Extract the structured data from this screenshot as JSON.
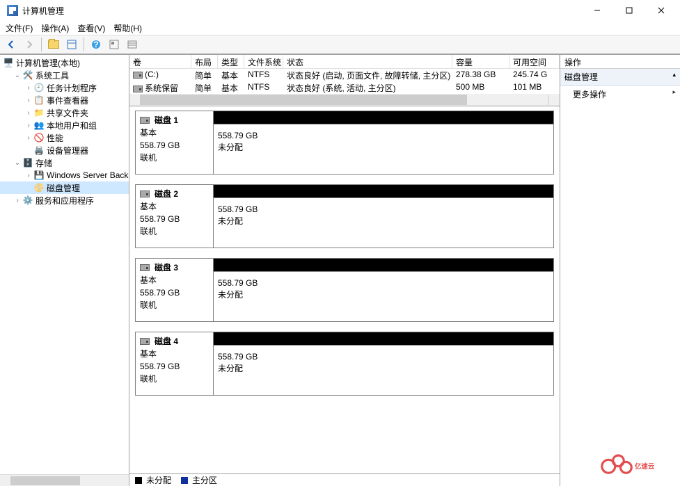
{
  "window": {
    "title": "计算机管理"
  },
  "menus": {
    "file": "文件(F)",
    "action": "操作(A)",
    "view": "查看(V)",
    "help": "帮助(H)"
  },
  "tree": {
    "root": "计算机管理(本地)",
    "system_tools": "系统工具",
    "task_scheduler": "任务计划程序",
    "event_viewer": "事件查看器",
    "shared_folders": "共享文件夹",
    "local_users": "本地用户和组",
    "performance": "性能",
    "device_manager": "设备管理器",
    "storage": "存储",
    "wsb": "Windows Server Back",
    "disk_mgmt": "磁盘管理",
    "services": "服务和应用程序"
  },
  "vol_headers": {
    "volume": "卷",
    "layout": "布局",
    "type": "类型",
    "fs": "文件系统",
    "status": "状态",
    "capacity": "容量",
    "free": "可用空间"
  },
  "volumes": [
    {
      "name": "(C:)",
      "layout": "简单",
      "type": "基本",
      "fs": "NTFS",
      "status": "状态良好 (启动, 页面文件, 故障转储, 主分区)",
      "capacity": "278.38 GB",
      "free": "245.74 G"
    },
    {
      "name": "系统保留",
      "layout": "简单",
      "type": "基本",
      "fs": "NTFS",
      "status": "状态良好 (系统, 活动, 主分区)",
      "capacity": "500 MB",
      "free": "101 MB"
    }
  ],
  "disks": [
    {
      "label": "磁盘 1",
      "type": "基本",
      "size": "558.79 GB",
      "state": "联机",
      "area_size": "558.79 GB",
      "area_state": "未分配"
    },
    {
      "label": "磁盘 2",
      "type": "基本",
      "size": "558.79 GB",
      "state": "联机",
      "area_size": "558.79 GB",
      "area_state": "未分配"
    },
    {
      "label": "磁盘 3",
      "type": "基本",
      "size": "558.79 GB",
      "state": "联机",
      "area_size": "558.79 GB",
      "area_state": "未分配"
    },
    {
      "label": "磁盘 4",
      "type": "基本",
      "size": "558.79 GB",
      "state": "联机",
      "area_size": "558.79 GB",
      "area_state": "未分配"
    }
  ],
  "legend": {
    "unallocated": "未分配",
    "primary": "主分区"
  },
  "actions": {
    "header": "操作",
    "section": "磁盘管理",
    "more": "更多操作"
  },
  "watermark": "亿速云"
}
